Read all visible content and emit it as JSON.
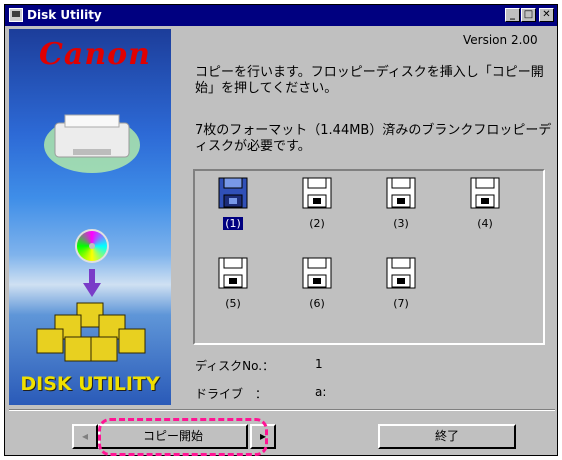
{
  "window": {
    "title": "Disk Utility",
    "version": "Version 2.00"
  },
  "sidebar": {
    "brand": "Canon",
    "product_text": "DISK UTILITY"
  },
  "messages": {
    "line1": "コピーを行います。フロッピーディスクを挿入し「コピー開始」を押してください。",
    "line2": "7枚のフォーマット（1.44MB）済みのブランクフロッピーディスクが必要です。"
  },
  "disks": [
    {
      "label": "(1)",
      "selected": true
    },
    {
      "label": "(2)",
      "selected": false
    },
    {
      "label": "(3)",
      "selected": false
    },
    {
      "label": "(4)",
      "selected": false
    },
    {
      "label": "(5)",
      "selected": false
    },
    {
      "label": "(6)",
      "selected": false
    },
    {
      "label": "(7)",
      "selected": false
    }
  ],
  "status": {
    "disk_no_label": "ディスクNo.：",
    "disk_no_value": "1",
    "drive_label": "ドライブ　：",
    "drive_value": "a:"
  },
  "buttons": {
    "prev_symbol": "◂",
    "copy_start": "コピー開始",
    "next_symbol": "▸",
    "quit": "終了"
  },
  "icons": {
    "app": "disk-utility-app-icon",
    "minimize": "minimize-icon",
    "maximize": "maximize-icon",
    "close": "close-icon",
    "floppy": "floppy-disk-icon"
  }
}
